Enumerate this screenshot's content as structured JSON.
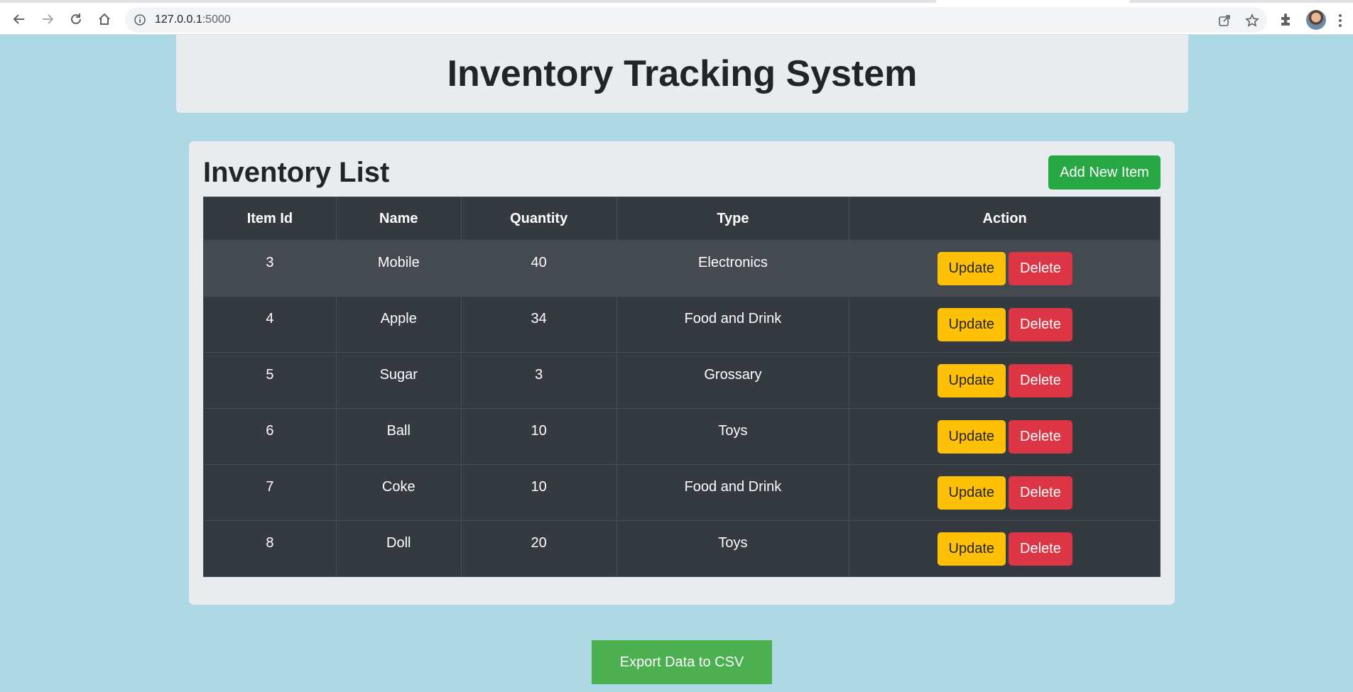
{
  "browser": {
    "url_host": "127.0.0.1",
    "url_port": ":5000",
    "icons": [
      "back-icon",
      "forward-icon",
      "reload-icon",
      "home-icon",
      "info-icon",
      "share-icon",
      "star-icon",
      "extensions-icon",
      "avatar",
      "menu-icon"
    ]
  },
  "header": {
    "title": "Inventory Tracking System"
  },
  "inventory": {
    "title": "Inventory List",
    "add_label": "Add New Item",
    "columns": [
      "Item Id",
      "Name",
      "Quantity",
      "Type",
      "Action"
    ],
    "rows": [
      {
        "id": "3",
        "name": "Mobile",
        "quantity": "40",
        "type": "Electronics"
      },
      {
        "id": "4",
        "name": "Apple",
        "quantity": "34",
        "type": "Food and Drink"
      },
      {
        "id": "5",
        "name": "Sugar",
        "quantity": "3",
        "type": "Grossary"
      },
      {
        "id": "6",
        "name": "Ball",
        "quantity": "10",
        "type": "Toys"
      },
      {
        "id": "7",
        "name": "Coke",
        "quantity": "10",
        "type": "Food and Drink"
      },
      {
        "id": "8",
        "name": "Doll",
        "quantity": "20",
        "type": "Toys"
      }
    ],
    "update_label": "Update",
    "delete_label": "Delete"
  },
  "export_label": "Export Data to CSV",
  "colors": {
    "page_bg": "#add8e6",
    "card_bg": "#e9ecef",
    "table_bg": "#343a40",
    "add_button": "#28a745",
    "update_button": "#ffc107",
    "delete_button": "#dc3545",
    "export_button": "#4caf50"
  }
}
